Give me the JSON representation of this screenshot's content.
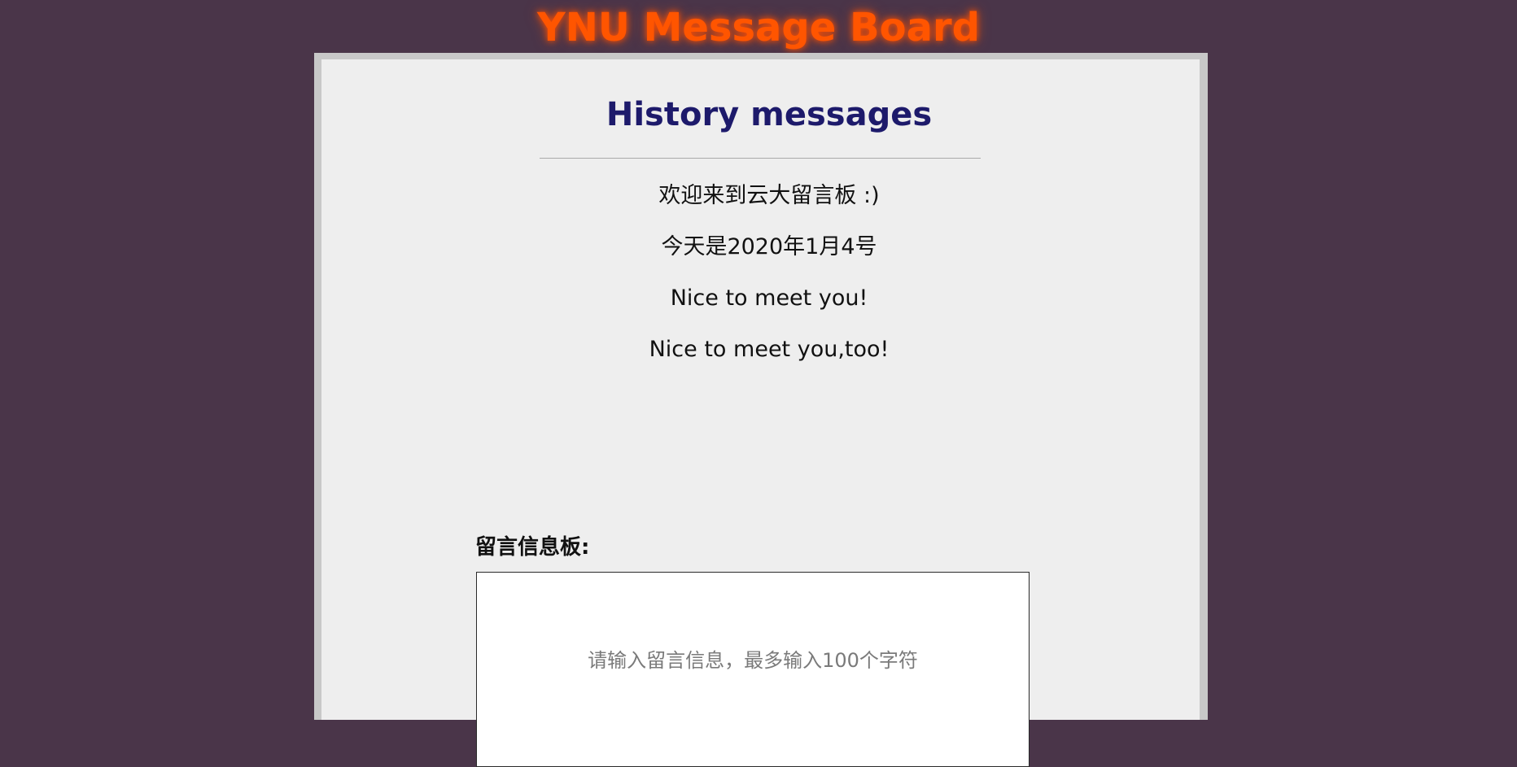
{
  "header": {
    "site_title": "YNU Message Board"
  },
  "history": {
    "title": "History messages",
    "messages": [
      "欢迎来到云大留言板 :)",
      "今天是2020年1月4号",
      "Nice to meet you!",
      "Nice to meet you,too!"
    ]
  },
  "board": {
    "label": "留言信息板:",
    "placeholder": "请输入留言信息，最多输入100个字符"
  },
  "colors": {
    "page_background": "#4a3549",
    "site_title": "#ff5500",
    "history_title": "#1d1a6b",
    "panel_background": "#eeeeee"
  }
}
